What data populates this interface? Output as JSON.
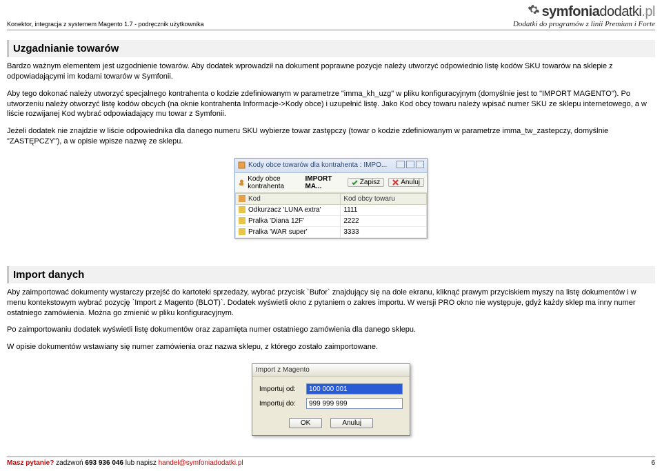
{
  "header": {
    "left": "Konektor, integracja z systemem Magento 1.7 - podręcznik użytkownika",
    "brand_main": "symfonia",
    "brand_mid": "dodatki",
    "brand_suffix": ".pl",
    "brand_sub": "Dodatki do programów z linii Premium i Forte"
  },
  "section1": {
    "title": "Uzgadnianie towarów",
    "p1": "Bardzo ważnym elementem jest uzgodnienie towarów. Aby dodatek wprowadził na dokument poprawne pozycje należy utworzyć odpowiednio listę kodów SKU towarów na sklepie z odpowiadającymi im kodami towarów w Symfonii.",
    "p2": "Aby tego dokonać należy utworzyć specjalnego kontrahenta o kodzie zdefiniowanym w parametrze \"imma_kh_uzg\" w pliku konfiguracyjnym (domyślnie jest to \"IMPORT MAGENTO\"). Po utworzeniu należy otworzyć listę kodów obcych (na oknie kontrahenta Informacje->Kody obce) i uzupełnić listę. Jako Kod obcy towaru należy wpisać numer SKU ze sklepu internetowego, a w liście rozwijanej Kod wybrać odpowiadający mu towar z Symfonii.",
    "p3": "Jeżeli dodatek nie znajdzie w liście odpowiednika dla danego numeru SKU wybierze towar zastępczy (towar o kodzie zdefiniowanym w parametrze imma_tw_zastepczy, domyślnie \"ZASTĘPCZY\"), a w opisie wpisze nazwę ze sklepu."
  },
  "dlg1": {
    "title": "Kody obce towarów dla kontrahenta : IMPO...",
    "toolbar_label": "Kody obce kontrahenta",
    "toolbar_value": "IMPORT MA...",
    "save": "Zapisz",
    "cancel": "Anuluj",
    "col_kod": "Kod",
    "col_kodobcy": "Kod obcy towaru",
    "rows": [
      {
        "kod": "Odkurzacz 'LUNA extra'",
        "obcy": "1111"
      },
      {
        "kod": "Pralka 'Diana 12F'",
        "obcy": "2222"
      },
      {
        "kod": "Pralka 'WAR super'",
        "obcy": "3333"
      }
    ]
  },
  "section2": {
    "title": "Import danych",
    "p1": "Aby zaimportować dokumenty wystarczy przejść do kartoteki sprzedaży, wybrać przycisk `Bufor` znajdujący się na dole ekranu, kliknąć prawym przyciskiem myszy na listę dokumentów i w menu kontekstowym wybrać pozycję `Import z Magento (BLOT)`. Dodatek wyświetli okno z pytaniem o zakres importu. W wersji PRO okno nie występuje, gdyż każdy sklep ma inny numer ostatniego zamówienia. Można go zmienić w pliku konfiguracyjnym.",
    "p2": "Po zaimportowaniu dodatek wyświetli listę dokumentów oraz zapamięta numer ostatniego zamówienia dla danego sklepu.",
    "p3": "W opisie dokumentów wstawiany się numer zamówienia oraz nazwa sklepu, z którego zostało zaimportowane."
  },
  "dlg2": {
    "title": "Import z Magento",
    "from_label": "Importuj od:",
    "to_label": "Importuj do:",
    "from_value": "100 000 001",
    "to_value": "999 999 999",
    "ok": "OK",
    "cancel": "Anuluj"
  },
  "footer": {
    "prefix": "Masz pytanie?",
    "mid": " zadzwoń ",
    "phone": "693 936 046",
    "mid2": " lub napisz ",
    "email": "handel@symfoniadodatki.pl",
    "page": "6"
  }
}
